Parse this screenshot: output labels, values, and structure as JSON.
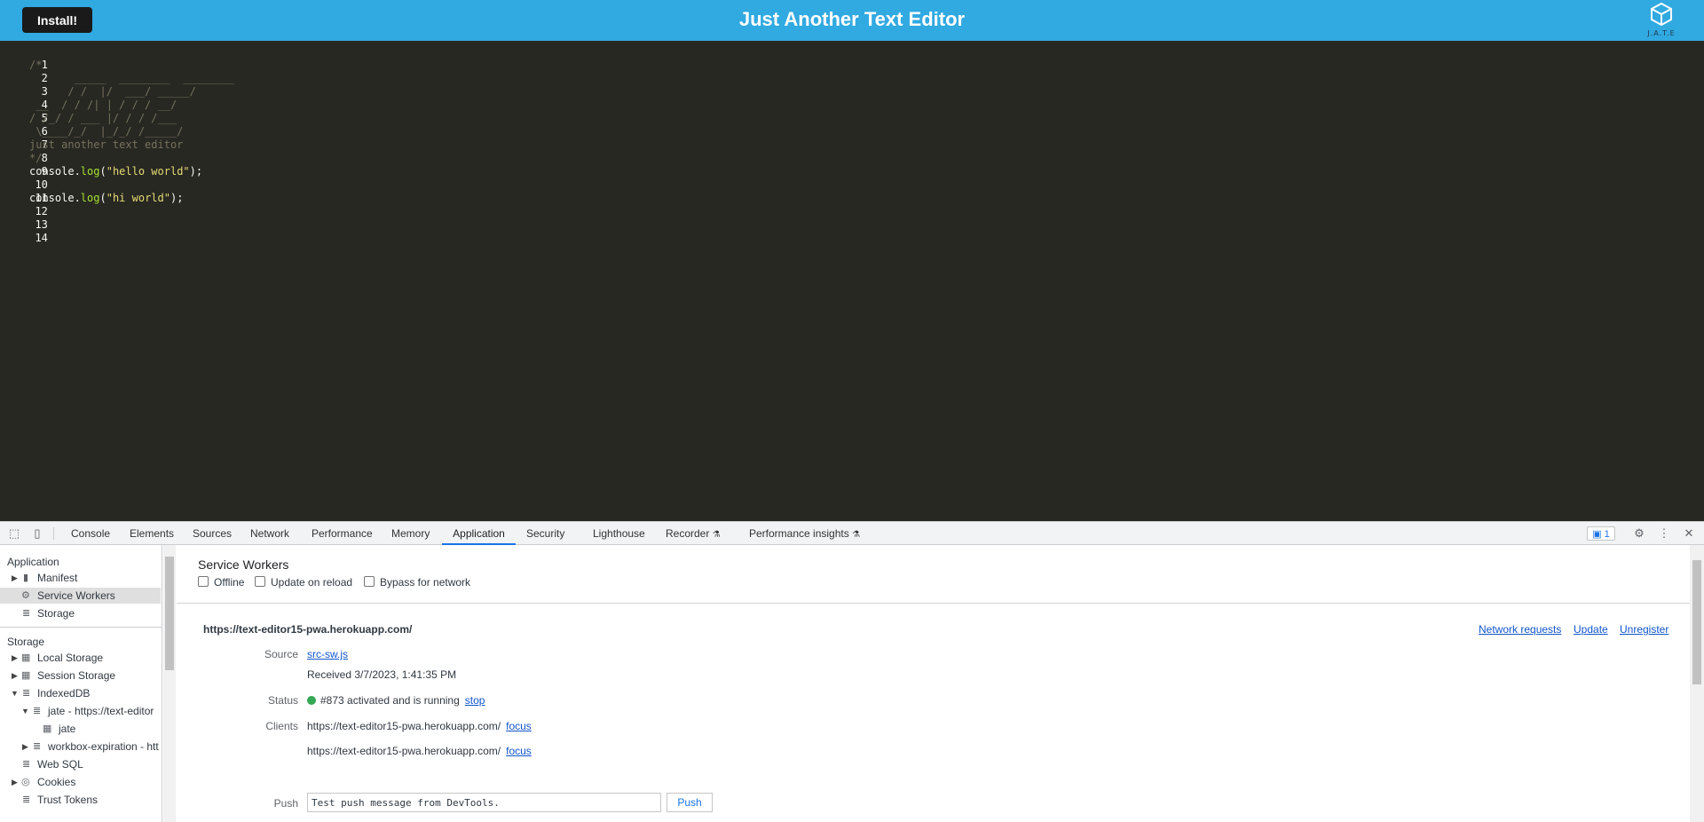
{
  "app": {
    "title": "Just Another Text Editor",
    "install_label": "Install!",
    "logo_text": "J.A.T.E",
    "header_color": "#31a9e1"
  },
  "editor": {
    "line_numbers": [
      "1",
      "2",
      "3",
      "4",
      "5",
      "6",
      "7",
      "8",
      "9",
      "10",
      "11",
      "12",
      "13",
      "14"
    ],
    "lines": [
      "",
      "/*",
      "       _____  ________  ________",
      "      / /  |/  ___/ _____/",
      " __  / / /| | / / / __/",
      "/ /_/ / ___ |/ / / /___",
      " \\____/_/  |_/_/ /_____/",
      "just another text editor",
      "*/",
      "console.log(\"hello world\");",
      "",
      "console.log(\"hi world\");",
      "",
      ""
    ],
    "code_line_10": {
      "obj": "console.",
      "fn": "log",
      "open": "(",
      "str": "\"hello world\"",
      "close": ");"
    },
    "code_line_12": {
      "obj": "console.",
      "fn": "log",
      "open": "(",
      "str": "\"hi world\"",
      "close": ");"
    }
  },
  "devtools": {
    "tabs": [
      "Console",
      "Elements",
      "Sources",
      "Network",
      "Performance",
      "Memory",
      "Application",
      "Security",
      "Lighthouse",
      "Recorder",
      "Performance insights"
    ],
    "active_tab": "Application",
    "issues_count": "1",
    "sidebar": {
      "application_header": "Application",
      "application_items": [
        "Manifest",
        "Service Workers",
        "Storage"
      ],
      "selected_item": "Service Workers",
      "storage_header": "Storage",
      "storage_items": [
        "Local Storage",
        "Session Storage",
        "IndexedDB",
        "jate - https://text-editor",
        "jate",
        "workbox-expiration - htt",
        "Web SQL",
        "Cookies",
        "Trust Tokens"
      ]
    },
    "service_workers": {
      "title": "Service Workers",
      "checkboxes": [
        "Offline",
        "Update on reload",
        "Bypass for network"
      ],
      "origin": "https://text-editor15-pwa.herokuapp.com/",
      "actions": [
        "Network requests",
        "Update",
        "Unregister"
      ],
      "source_label": "Source",
      "source_link": "src-sw.js",
      "received": "Received 3/7/2023, 1:41:35 PM",
      "status_label": "Status",
      "status_text": "#873 activated and is running",
      "status_action": "stop",
      "clients_label": "Clients",
      "clients": [
        "https://text-editor15-pwa.herokuapp.com/",
        "https://text-editor15-pwa.herokuapp.com/"
      ],
      "client_action": "focus",
      "push_label": "Push",
      "push_value": "Test push message from DevTools.",
      "push_button": "Push"
    }
  }
}
